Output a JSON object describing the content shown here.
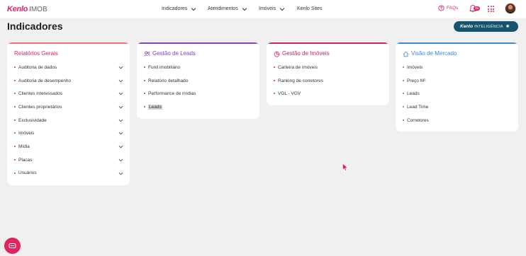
{
  "header": {
    "brand": "Kenlo",
    "product": "IMOB",
    "nav": [
      {
        "label": "Indicadores"
      },
      {
        "label": "Atendimentos"
      },
      {
        "label": "Imóveis"
      },
      {
        "label": "Kenlo Sites"
      }
    ],
    "faq_label": "FAQs",
    "notifications_count": "35"
  },
  "page": {
    "title": "Indicadores",
    "ki_button": {
      "brand": "Kenlo",
      "label": "INTELIGÊNCIA"
    }
  },
  "cards": [
    {
      "title": "Relatórios Gerais",
      "accent": "#f0717e",
      "items": [
        "Auditoria de dados",
        "Auditoria de desempenho",
        "Clientes interessados",
        "Clientes proprietários",
        "Exclusividade",
        "Imóveis",
        "Mídia",
        "Placas",
        "Usuários"
      ]
    },
    {
      "title": "Gestão de Leads",
      "accent": "#8a3fbf",
      "icon": "people-icon",
      "items": [
        "Funil imobiliário",
        "Relatório detalhado",
        "Performance de mídias",
        "Leads"
      ]
    },
    {
      "title": "Gestão de Imóveis",
      "accent": "#d6204f",
      "icon": "pie-chart-icon",
      "items": [
        "Carteira de imóveis",
        "Ranking de corretores",
        "VGL - VGV"
      ]
    },
    {
      "title": "Visão de Mercado",
      "accent": "#3a8ad8",
      "icon": "house-icon",
      "items": [
        "Imóveis",
        "Preço M²",
        "Leads",
        "Lead Time",
        "Corretores"
      ]
    }
  ]
}
